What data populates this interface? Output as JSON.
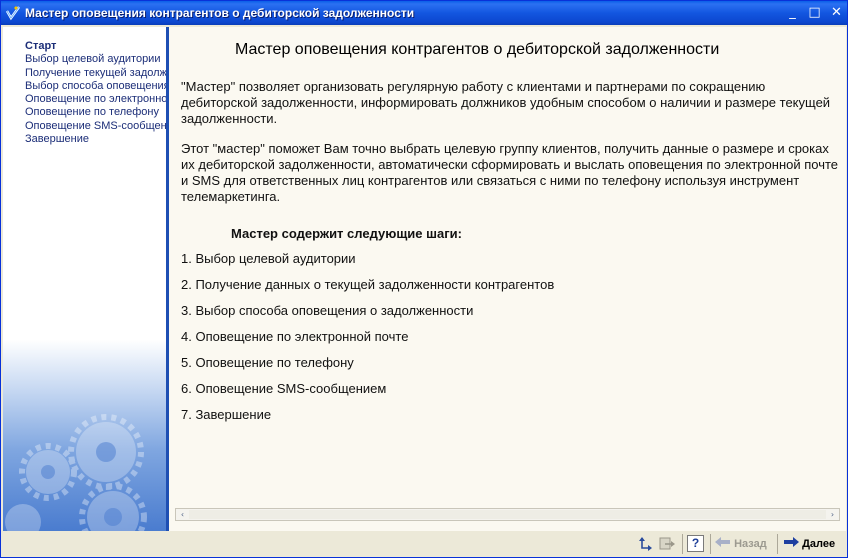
{
  "window": {
    "title": "Мастер оповещения контрагентов о дебиторской задолженности",
    "controls": {
      "minimize": "_",
      "maximize": "□",
      "close": "✕"
    },
    "accent": "#0A5FE8"
  },
  "sidebar": {
    "steps": [
      {
        "label": "Старт",
        "active": true
      },
      {
        "label": "Выбор целевой аудитории"
      },
      {
        "label": "Получение текущей задолженности контрагентов"
      },
      {
        "label": "Выбор способа оповещения о задолженности"
      },
      {
        "label": "Оповещение  по электронной почте"
      },
      {
        "label": "Оповещение по телефону"
      },
      {
        "label": "Оповещение SMS-сообщением"
      },
      {
        "label": "Завершение"
      }
    ]
  },
  "main": {
    "title": "Мастер оповещения контрагентов о дебиторской задолженности",
    "paragraph1": "\"Мастер\" позволяет организовать регулярную работу с клиентами и партнерами по сокращению дебиторской задолженности, информировать должников удобным способом о наличии и размере текущей задолженности.",
    "paragraph2": "Этот \"мастер\" поможет Вам точно выбрать целевую группу клиентов, получить данные о размере и сроках их дебиторской задолженности, автоматически сформировать и выслать оповещения по электронной почте и SMS для ответственных лиц контрагентов или связаться с ними по телефону используя инструмент телемаркетинга.",
    "steps_heading": "Мастер содержит следующие шаги:",
    "steps": [
      "1. Выбор целевой аудитории",
      "2. Получение данных о текущей задолженности контрагентов",
      "3. Выбор способа оповещения о задолженности",
      "4. Оповещение по электронной почте",
      "5. Оповещение по телефону",
      "6. Оповещение SMS-сообщением",
      "7. Завершение"
    ]
  },
  "scrollbar": {
    "left_arrow": "‹",
    "right_arrow": "›"
  },
  "toolbar": {
    "back_label": "Назад",
    "next_label": "Далее",
    "help_label": "?",
    "icons": [
      "undo-icon",
      "redo-icon",
      "help-icon",
      "back-arrow-icon",
      "next-arrow-icon"
    ]
  }
}
